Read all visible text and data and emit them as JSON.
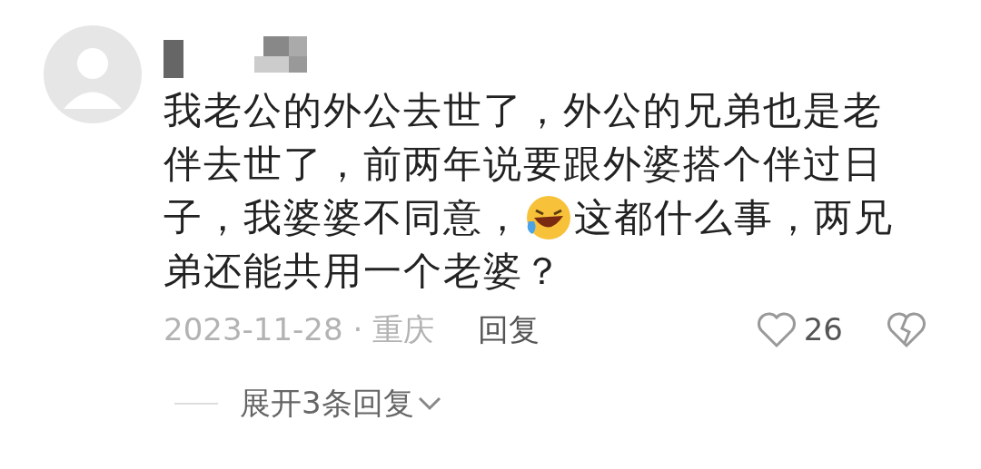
{
  "comment": {
    "lines": [
      [
        {
          "kind": "text",
          "text": "我老公的外公去世了，外公的兄弟也是老"
        }
      ],
      [
        {
          "kind": "text",
          "text": "伴去世了，前两年说要跟外婆搭个伴过日"
        }
      ],
      [
        {
          "kind": "text",
          "text": "子，我婆婆不同意，"
        },
        {
          "kind": "emoji"
        },
        {
          "kind": "text",
          "text": "这都什么事，两兄"
        }
      ],
      [
        {
          "kind": "text",
          "text": "弟还能共用一个老婆？"
        }
      ]
    ],
    "date": "2023-11-28",
    "separator": "·",
    "location": "重庆",
    "reply_label": "回复",
    "likes": "26",
    "liked": false
  },
  "replies": {
    "label": "展开3条回复"
  }
}
